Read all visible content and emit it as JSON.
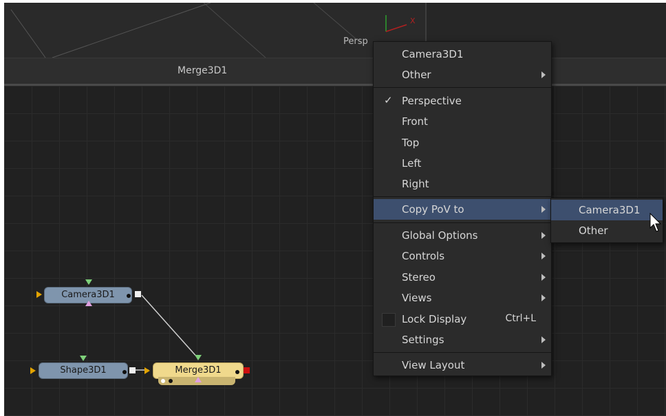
{
  "viewer": {
    "view_label": "Persp"
  },
  "header": {
    "title": "Merge3D1"
  },
  "nodes": {
    "camera": "Camera3D1",
    "shape": "Shape3D1",
    "merge": "Merge3D1"
  },
  "context_menu": {
    "top_items": [
      {
        "label": "Camera3D1"
      },
      {
        "label": "Other",
        "submenu": true
      }
    ],
    "view_items": [
      {
        "label": "Perspective",
        "checked": true
      },
      {
        "label": "Front"
      },
      {
        "label": "Top"
      },
      {
        "label": "Left"
      },
      {
        "label": "Right"
      }
    ],
    "copy_pov": {
      "label": "Copy PoV to",
      "submenu": true,
      "highlighted": true
    },
    "bottom_items": [
      {
        "label": "Global Options",
        "submenu": true
      },
      {
        "label": "Controls",
        "submenu": true
      },
      {
        "label": "Stereo",
        "submenu": true
      },
      {
        "label": "Views",
        "submenu": true
      },
      {
        "label": "Lock Display",
        "shortcut": "Ctrl+L",
        "checkbox": true
      },
      {
        "label": "Settings",
        "submenu": true
      }
    ],
    "layout_item": {
      "label": "View Layout",
      "submenu": true
    }
  },
  "submenu": {
    "items": [
      {
        "label": "Camera3D1",
        "highlighted": true
      },
      {
        "label": "Other"
      }
    ]
  },
  "colors": {
    "highlight": "#3d4f6e",
    "node_blue": "#7f95ad",
    "node_yellow": "#f0d98c",
    "input_triangle": "#e2a300"
  }
}
